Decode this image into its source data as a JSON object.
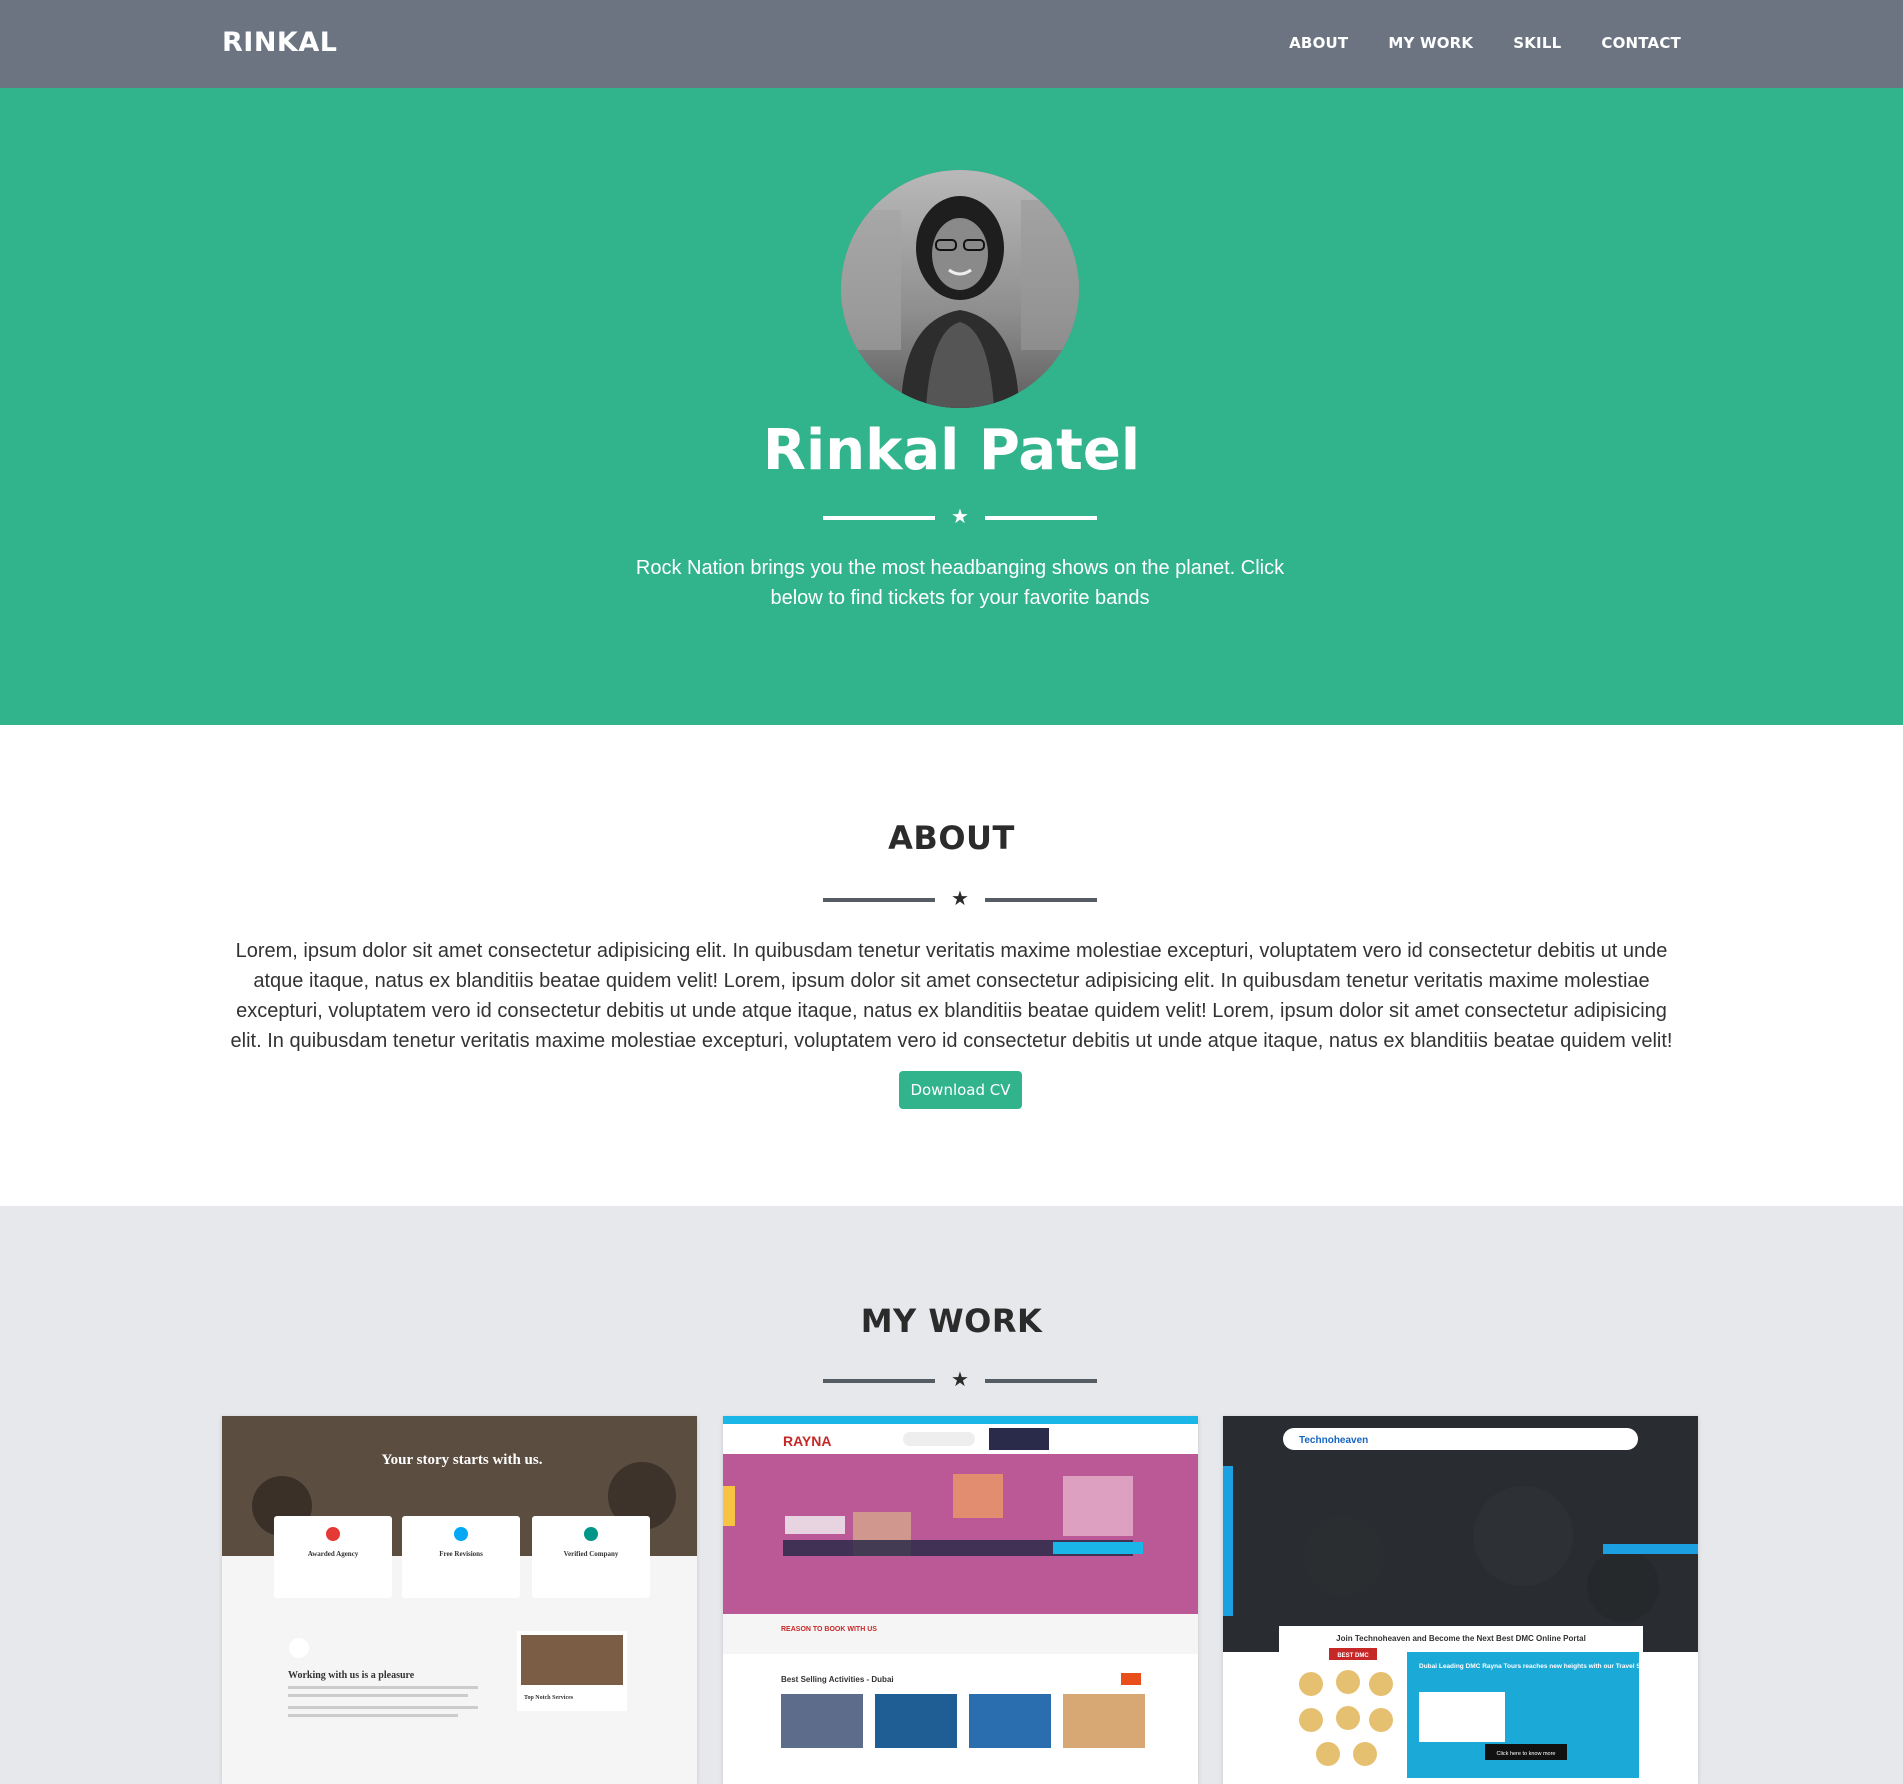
{
  "nav": {
    "brand": "RINKAL",
    "links": [
      "ABOUT",
      "MY WORK",
      "SKILL",
      "CONTACT"
    ]
  },
  "hero": {
    "name": "Rinkal Patel",
    "tagline": "Rock Nation brings you the most headbanging shows on the planet. Click below to find tickets for your favorite bands"
  },
  "about": {
    "title": "ABOUT",
    "text": "Lorem, ipsum dolor sit amet consectetur adipisicing elit. In quibusdam tenetur veritatis maxime molestiae excepturi, voluptatem vero id consectetur debitis ut unde atque itaque, natus ex blanditiis beatae quidem velit! Lorem, ipsum dolor sit amet consectetur adipisicing elit. In quibusdam tenetur veritatis maxime molestiae excepturi, voluptatem vero id consectetur debitis ut unde atque itaque, natus ex blanditiis beatae quidem velit! Lorem, ipsum dolor sit amet consectetur adipisicing elit. In quibusdam tenetur veritatis maxime molestiae excepturi, voluptatem vero id consectetur debitis ut unde atque itaque, natus ex blanditiis beatae quidem velit!",
    "button": "Download CV"
  },
  "work": {
    "title": "MY WORK",
    "projects": [
      {
        "headline": "Your story starts with us.",
        "features": [
          "Awarded Agency",
          "Free Revisions",
          "Verified Company"
        ],
        "section": "Working with us is a pleasure",
        "side": "Top Notch Services"
      },
      {
        "logo": "RAYNA",
        "reason": "REASON TO BOOK WITH US",
        "best": "Best Selling Activities - Dubai"
      },
      {
        "logo": "Technoheaven",
        "banner": "Join Technoheaven and Become the Next Best DMC Online Portal",
        "badge": "BEST DMC",
        "promo": "Dubai Leading DMC Rayna Tours reaches new heights with our Travel Solution",
        "cta": "Click here to know more"
      }
    ]
  },
  "colors": {
    "navbar": "#6b7480",
    "accent": "#31b38b",
    "work_bg": "#e6e8eb"
  }
}
